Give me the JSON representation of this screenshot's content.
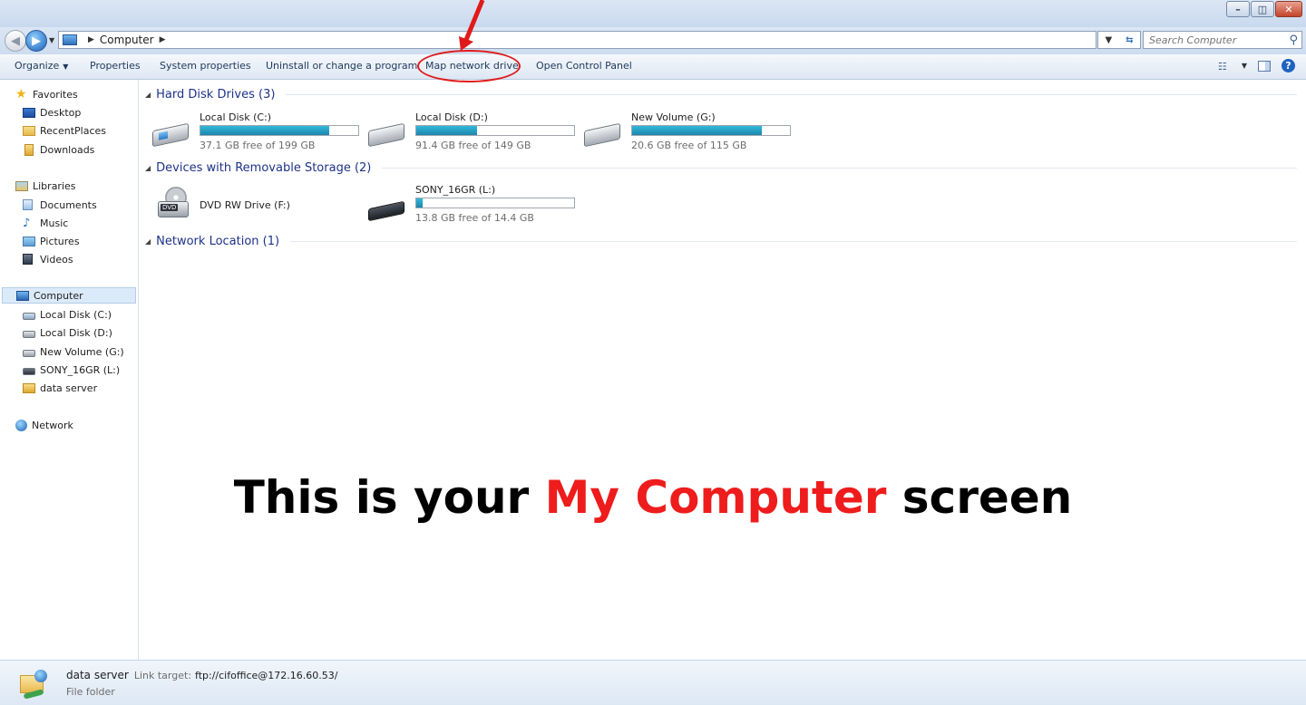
{
  "address": {
    "crumbs": [
      "Computer"
    ],
    "search_placeholder": "Search Computer"
  },
  "toolbar": {
    "organize": "Organize",
    "properties": "Properties",
    "system_properties": "System properties",
    "uninstall": "Uninstall or change a program",
    "map_network_drive": "Map network drive",
    "open_control_panel": "Open Control Panel",
    "highlight_color": "#e01a1a"
  },
  "sidebar": {
    "favorites": "Favorites",
    "favorites_items": [
      "Desktop",
      "RecentPlaces",
      "Downloads"
    ],
    "libraries": "Libraries",
    "libraries_items": [
      "Documents",
      "Music",
      "Pictures",
      "Videos"
    ],
    "computer": "Computer",
    "computer_items": [
      "Local Disk (C:)",
      "Local Disk (D:)",
      "New Volume (G:)",
      "SONY_16GR (L:)",
      "data server"
    ],
    "network": "Network"
  },
  "content": {
    "hard_disk_header": "Hard Disk Drives (3)",
    "drives": [
      {
        "name": "Local Disk (C:)",
        "free": "37.1 GB free of 199 GB",
        "used_fraction": 0.814
      },
      {
        "name": "Local Disk (D:)",
        "free": "91.4 GB free of 149 GB",
        "used_fraction": 0.387
      },
      {
        "name": "New Volume (G:)",
        "free": "20.6 GB free of 115 GB",
        "used_fraction": 0.821
      }
    ],
    "removable_header": "Devices with Removable Storage (2)",
    "dvd": {
      "name": "DVD RW Drive (F:)",
      "badge": "DVD"
    },
    "usb": {
      "name": "SONY_16GR (L:)",
      "free": "13.8 GB free of 14.4 GB",
      "used_fraction": 0.042
    },
    "network_header": "Network Location (1)"
  },
  "caption": {
    "before": "This is your ",
    "highlight": "My Computer",
    "after": " screen",
    "highlight_color": "#ee1c1c"
  },
  "details": {
    "name": "data server",
    "link_label": "Link target:",
    "link_value": "ftp://cifoffice@172.16.60.53/",
    "type": "File folder"
  }
}
